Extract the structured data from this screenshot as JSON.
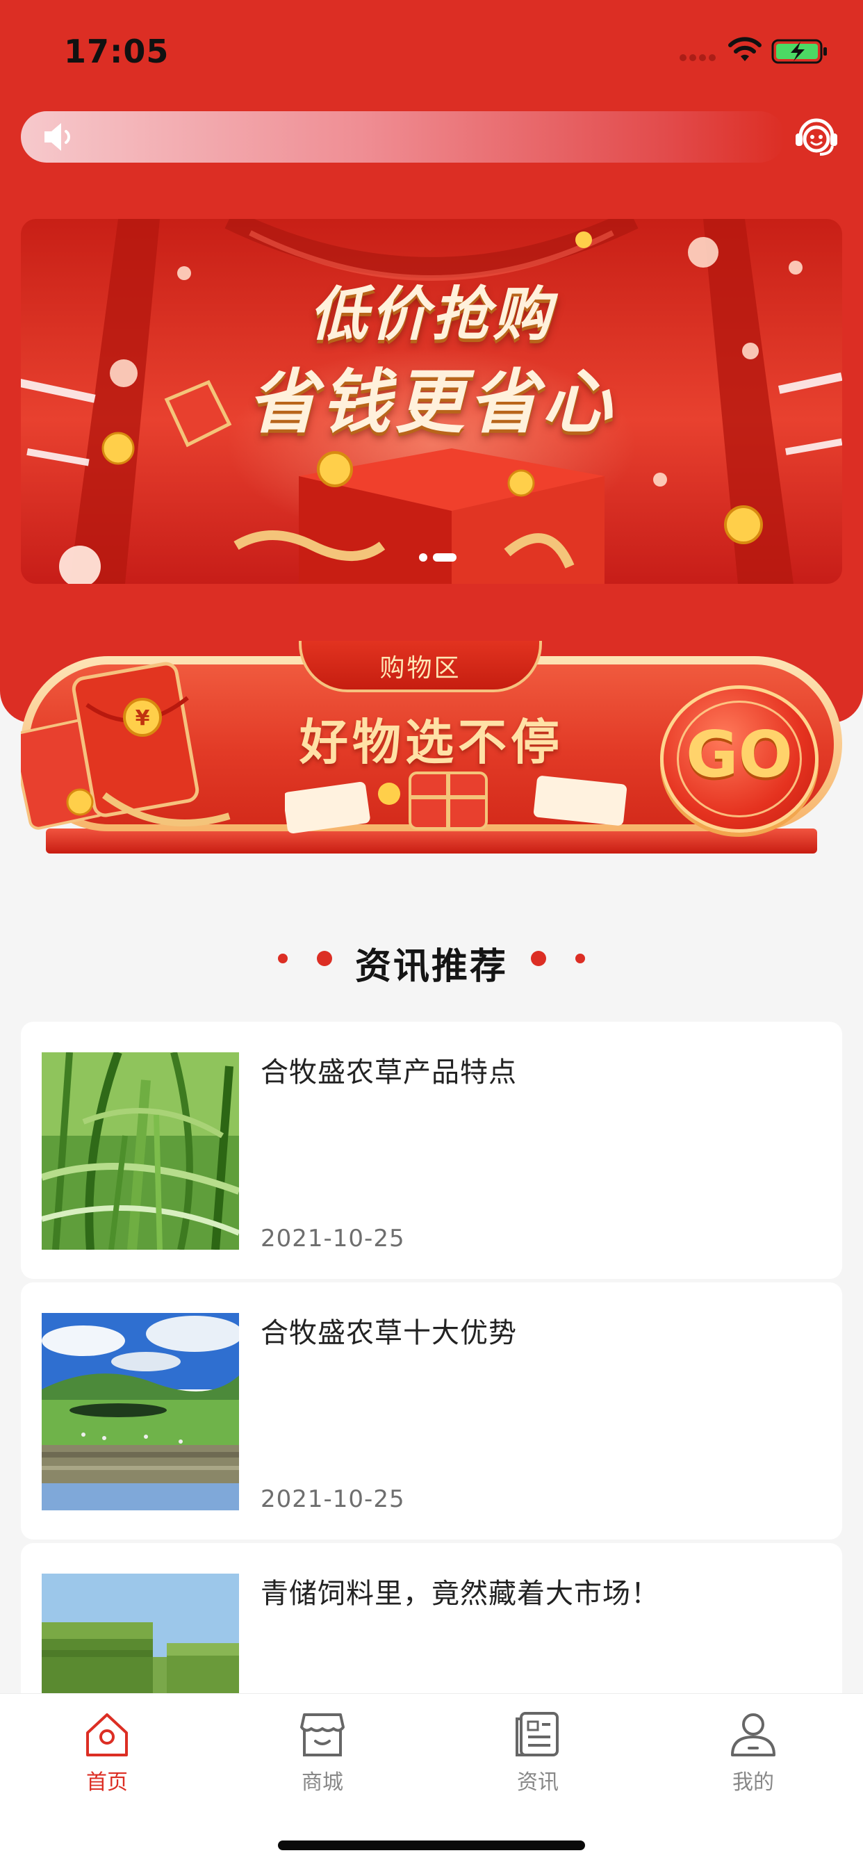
{
  "status_bar": {
    "time": "17:05",
    "wifi_icon": "wifi-icon",
    "battery_icon": "battery-charging-icon"
  },
  "notice_bar": {
    "speaker_icon": "speaker-icon",
    "support_icon": "customer-service-icon"
  },
  "banner": {
    "line1": "低价抢购",
    "line2": "省钱更省心",
    "slide_count": 2,
    "active_slide": 2
  },
  "shop_zone": {
    "tab_label": "购物区",
    "slogan": "好物选不停",
    "go_label": "GO"
  },
  "news_section": {
    "title": "资讯推荐",
    "items": [
      {
        "title": "合牧盛农草产品特点",
        "date": "2021-10-25",
        "thumb": "grass-closeup"
      },
      {
        "title": "合牧盛农草十大优势",
        "date": "2021-10-25",
        "thumb": "grassland-landscape"
      },
      {
        "title": "青储饲料里，竟然藏着大市场！",
        "date": "",
        "thumb": "hay-bales"
      }
    ]
  },
  "tab_bar": {
    "items": [
      {
        "label": "首页",
        "icon": "home-icon",
        "active": true
      },
      {
        "label": "商城",
        "icon": "shop-icon",
        "active": false
      },
      {
        "label": "资讯",
        "icon": "news-icon",
        "active": false
      },
      {
        "label": "我的",
        "icon": "profile-icon",
        "active": false
      }
    ]
  },
  "colors": {
    "brand_red": "#dc2e24",
    "gold": "#ffd36b",
    "page_bg": "#f5f5f5"
  }
}
